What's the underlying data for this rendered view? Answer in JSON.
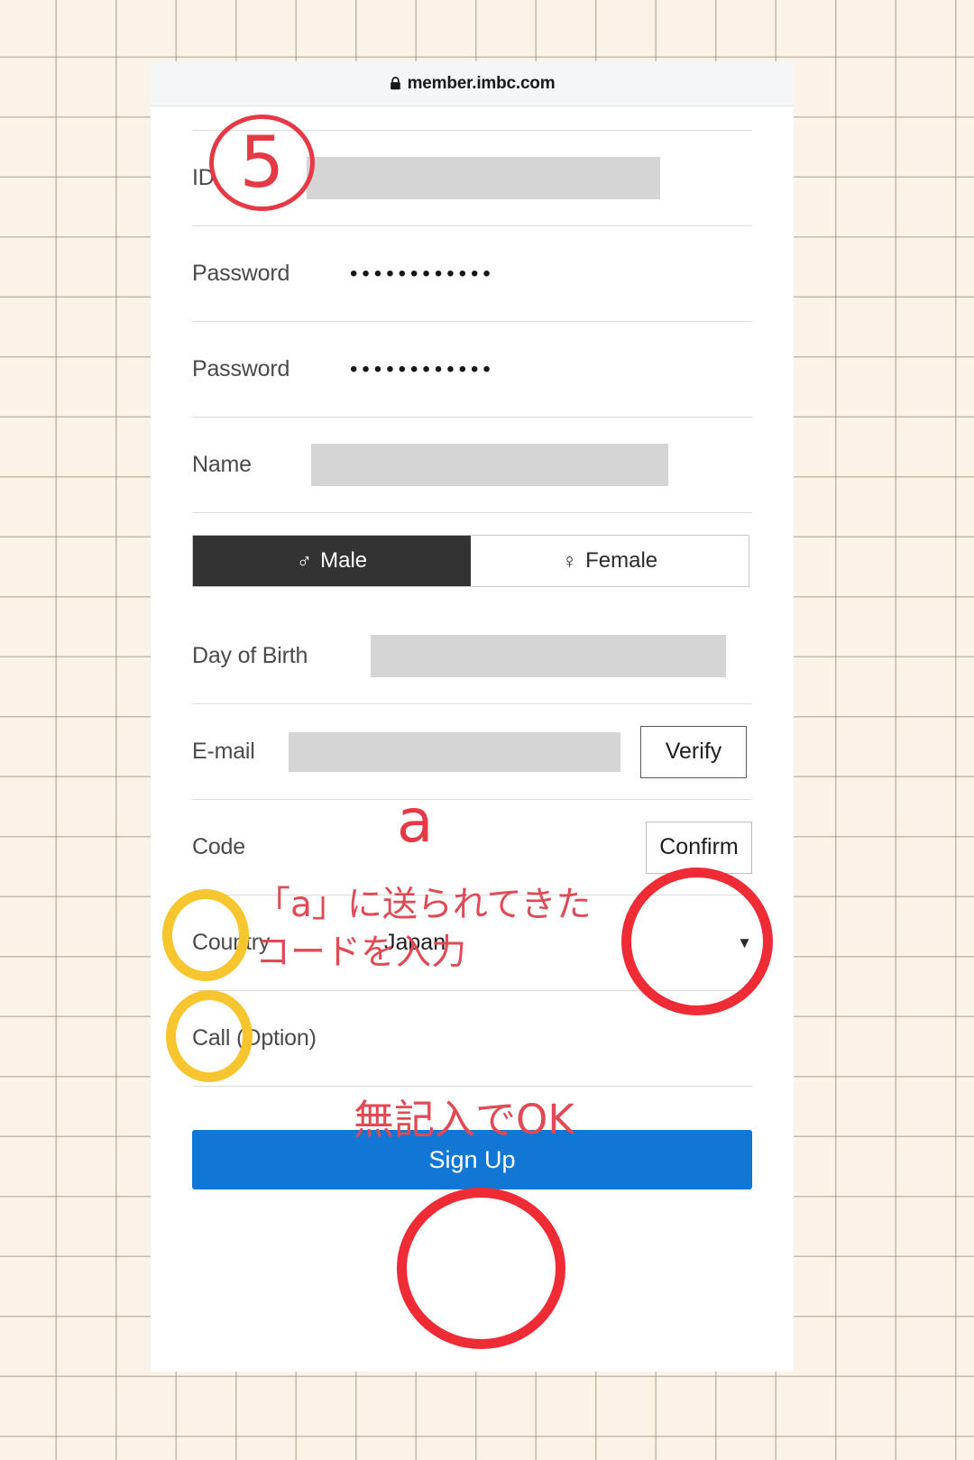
{
  "browser": {
    "lock_icon": "lock-icon",
    "url": "member.imbc.com"
  },
  "form": {
    "fields": [
      {
        "label": "ID",
        "value": "",
        "redacted": true
      },
      {
        "label": "Password",
        "value": "••••••••••••",
        "redacted": false
      },
      {
        "label": "Password",
        "value": "••••••••••••",
        "redacted": false
      },
      {
        "label": "Name",
        "value": "",
        "redacted": true
      },
      {
        "label": "Day of Birth",
        "value": "",
        "redacted": true
      },
      {
        "label": "E-mail",
        "value": "",
        "redacted": true
      },
      {
        "label": "Code",
        "value": "",
        "redacted": false
      },
      {
        "label": "Country",
        "value": "Japan",
        "redacted": false
      },
      {
        "label": "Call (Option)",
        "value": "",
        "redacted": false
      }
    ],
    "gender": {
      "male_label": "Male",
      "male_symbol": "♂",
      "female_label": "Female",
      "female_symbol": "♀",
      "selected": "Male"
    },
    "verify_button": "Verify",
    "confirm_button": "Confirm",
    "country_caret": "▼",
    "signup_button": "Sign Up"
  },
  "annotations": {
    "step_number": "5",
    "email_marker": "a",
    "code_note": "「a」に送られてきた\nコードを入力",
    "call_note": "無記入でOK",
    "colors": {
      "red": "#e63946",
      "yellow": "#f7c52d",
      "blue": "#1277d4",
      "dark": "#333333"
    }
  }
}
